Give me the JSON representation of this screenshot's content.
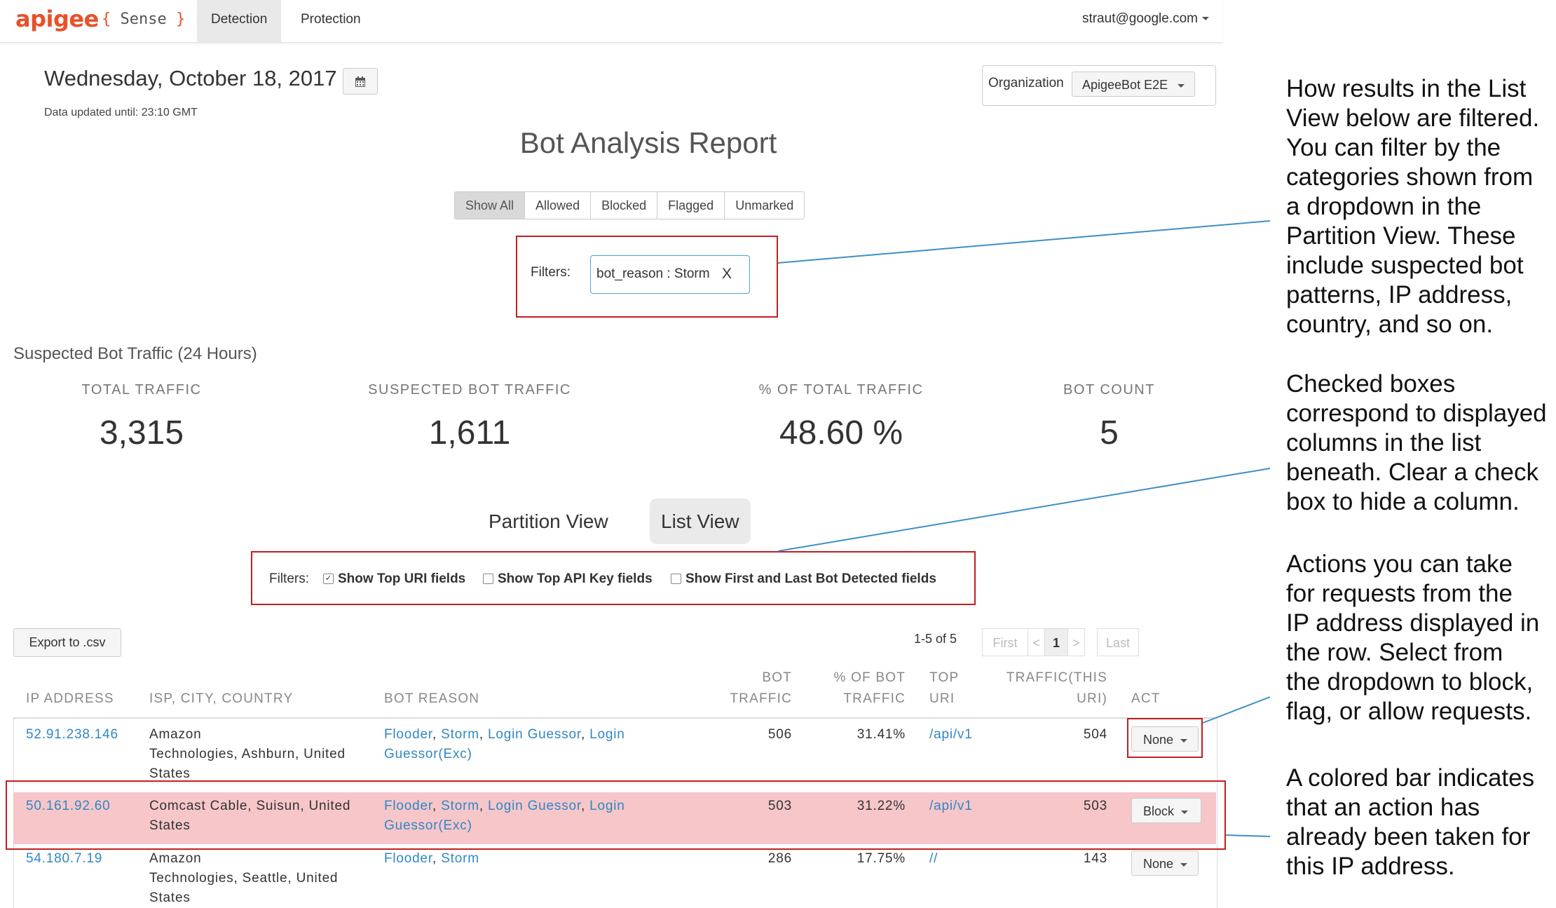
{
  "nav": {
    "logo": "apigee",
    "product_open": "{",
    "product_name": "Sense",
    "product_close": "}",
    "tabs": [
      "Detection",
      "Protection"
    ],
    "active_tab": "Detection",
    "user": "straut@google.com"
  },
  "header": {
    "date": "Wednesday, October 18, 2017",
    "calendar_icon": "calendar-icon",
    "updated": "Data updated until: 23:10 GMT",
    "org_label": "Organization",
    "org_value": "ApigeeBot E2E"
  },
  "report": {
    "title": "Bot Analysis Report",
    "filter_buttons": [
      "Show All",
      "Allowed",
      "Blocked",
      "Flagged",
      "Unmarked"
    ],
    "active_filter": "Show All",
    "filters_label": "Filters:",
    "filter_chip": "bot_reason : Storm",
    "filter_chip_remove": "X"
  },
  "summary": {
    "title": "Suspected Bot Traffic (24 Hours)",
    "kpis": [
      {
        "label": "TOTAL TRAFFIC",
        "value": "3,315"
      },
      {
        "label": "SUSPECTED BOT TRAFFIC",
        "value": "1,611"
      },
      {
        "label": "% OF TOTAL TRAFFIC",
        "value": "48.60 %"
      },
      {
        "label": "BOT COUNT",
        "value": "5"
      }
    ]
  },
  "views": {
    "tabs": [
      "Partition View",
      "List View"
    ],
    "active": "List View"
  },
  "columns_filter": {
    "label": "Filters:",
    "options": [
      {
        "label": "Show Top URI fields",
        "checked": true
      },
      {
        "label": "Show Top API Key fields",
        "checked": false
      },
      {
        "label": "Show First and Last Bot Detected fields",
        "checked": false
      }
    ]
  },
  "list": {
    "export_label": "Export to .csv",
    "page_info": "1-5 of 5",
    "pager": [
      "First",
      "<",
      "1",
      ">",
      "Last"
    ],
    "headers": {
      "ip": "IP ADDRESS",
      "isp": "ISP, CITY, COUNTRY",
      "reason": "BOT REASON",
      "bot_traffic_1": "BOT",
      "bot_traffic_2": "TRAFFIC",
      "pct_1": "% OF BOT",
      "pct_2": "TRAFFIC",
      "uri_1": "TOP",
      "uri_2": "URI",
      "uri_traffic_1": "TRAFFIC(THIS",
      "uri_traffic_2": "URI)",
      "act": "ACT"
    },
    "rows": [
      {
        "ip": "52.91.238.146",
        "isp_lines": [
          "Amazon",
          "Technologies, Ashburn, United",
          "States"
        ],
        "reason_l1": [
          "Flooder",
          "Storm",
          "Login Guessor",
          "Login"
        ],
        "reason_l2": "Guessor(Exc)",
        "bot_traffic": "506",
        "pct": "31.41%",
        "uri": "/api/v1",
        "uri_traffic": "504",
        "action": "None"
      },
      {
        "ip": "50.161.92.60",
        "isp_lines": [
          "Comcast Cable, Suisun, United",
          "States"
        ],
        "reason_l1": [
          "Flooder",
          "Storm",
          "Login Guessor",
          "Login"
        ],
        "reason_l2": "Guessor(Exc)",
        "bot_traffic": "503",
        "pct": "31.22%",
        "uri": "/api/v1",
        "uri_traffic": "503",
        "action": "Block"
      },
      {
        "ip": "54.180.7.19",
        "isp_lines": [
          "Amazon",
          "Technologies, Seattle, United",
          "States"
        ],
        "reason_l1": [
          "Flooder",
          "Storm"
        ],
        "reason_l2": "",
        "bot_traffic": "286",
        "pct": "17.75%",
        "uri": "//",
        "uri_traffic": "143",
        "action": "None"
      }
    ]
  },
  "annotations": [
    [
      "How results in the List",
      "View below are filtered.",
      "You can filter by the",
      "categories shown from",
      "a dropdown in the",
      "Partition View. These",
      "include suspected bot",
      "patterns, IP address,",
      "country, and so on."
    ],
    [
      "Checked boxes",
      "correspond to displayed",
      "columns in the list",
      "beneath. Clear a check",
      "box to hide a column."
    ],
    [
      "Actions you can take",
      "for requests from the",
      "IP address displayed in",
      "the row. Select from",
      "the dropdown to block,",
      "flag, or allow requests."
    ],
    [
      "A colored bar indicates",
      "that an action has",
      "already been taken for",
      "this IP address."
    ]
  ],
  "colors": {
    "brand": "#e8512a",
    "link": "#2f88c5",
    "highlight_row": "#f6c6c9",
    "callout_box": "#c41e1e",
    "callout_line": "#3d8fc6",
    "chip_border": "#4aa3d8"
  }
}
